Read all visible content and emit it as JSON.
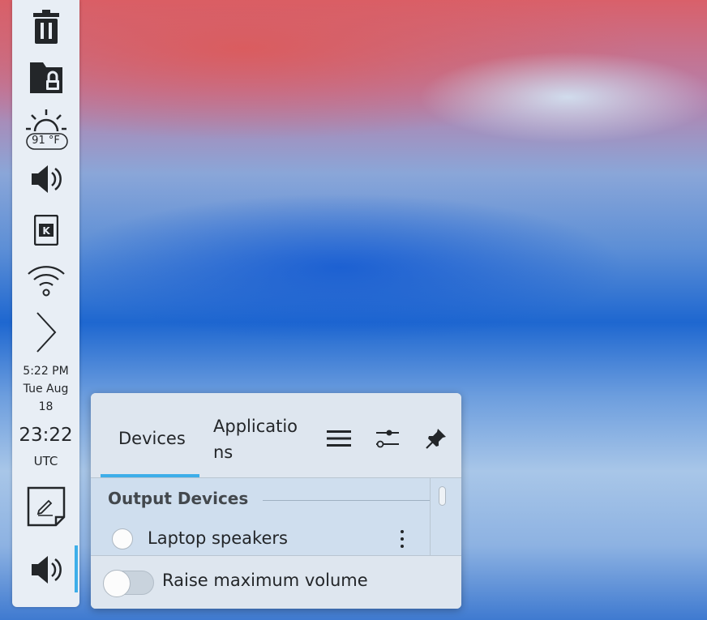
{
  "panel": {
    "weather_temp": "91 °F",
    "clock_time_12h": "5:22 PM",
    "clock_date_line1": "Tue Aug",
    "clock_date_line2": "18",
    "clock_time_24h": "23:22",
    "clock_timezone": "UTC",
    "icons": [
      "trash-icon",
      "locked-folder-icon",
      "weather-icon",
      "volume-icon",
      "kde-icon",
      "wifi-icon",
      "expand-arrow-icon",
      "notes-icon",
      "audio-volume-icon"
    ]
  },
  "audio_popup": {
    "tabs": [
      {
        "label": "Devices",
        "active": true
      },
      {
        "label": "Applications",
        "active": false
      }
    ],
    "header_icons": [
      "menu-icon",
      "settings-icon",
      "pin-icon"
    ],
    "section_title": "Output Devices",
    "device": {
      "name": "Laptop speakers",
      "selected": false
    },
    "footer_toggle": {
      "label": "Raise maximum volume",
      "enabled": false
    }
  },
  "colors": {
    "accent": "#3daee9",
    "panel_bg": "#e8eef5",
    "popup_bg": "#dee6ef",
    "text": "#232629"
  }
}
